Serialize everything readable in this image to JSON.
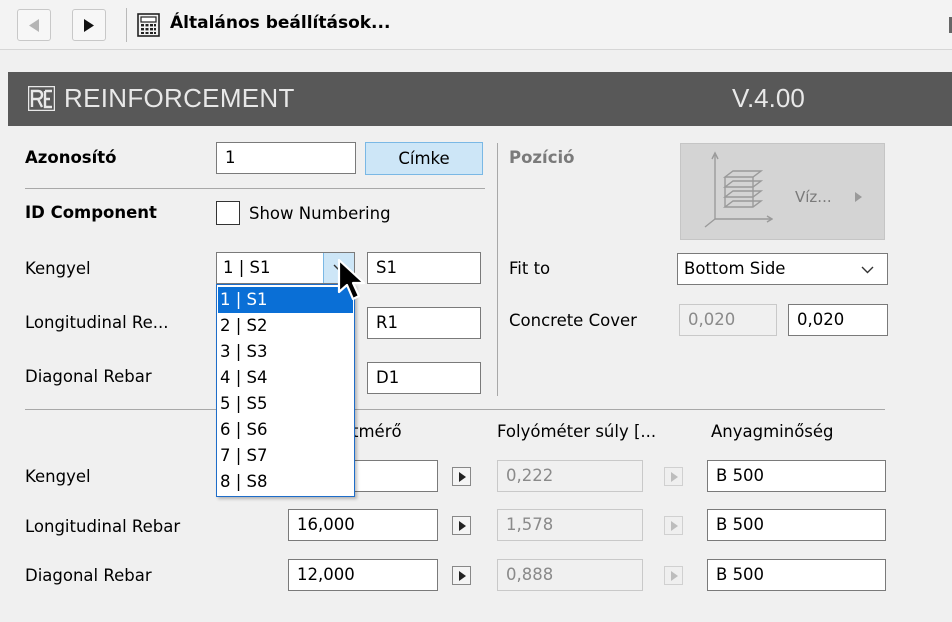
{
  "toolbar": {
    "title": "Általános beállítások..."
  },
  "banner": {
    "logo_text": "RE",
    "title": "REINFORCEMENT",
    "version": "V.4.00"
  },
  "id_section": {
    "azonosito_label": "Azonosító",
    "azonosito_value": "1",
    "cimke_button": "Címke",
    "id_component_label": "ID Component",
    "show_numbering_label": "Show Numbering",
    "show_numbering_checked": false
  },
  "rebar_ids": {
    "kengyel_label": "Kengyel",
    "kengyel_select": "1 | S1",
    "kengyel_id": "S1",
    "longitudinal_label": "Longitudinal Re...",
    "longitudinal_id": "R1",
    "diagonal_label": "Diagonal Rebar",
    "diagonal_id": "D1"
  },
  "position": {
    "pozicio_label": "Pozíció",
    "preview_label": "Víz...",
    "fit_to_label": "Fit to",
    "fit_to_value": "Bottom Side",
    "concrete_cover_label": "Concrete Cover",
    "concrete_cover_default": "0,020",
    "concrete_cover_value": "0,020"
  },
  "table": {
    "headers": {
      "diameter": "tmérő",
      "weight": "Folyóméter súly [...",
      "material": "Anyagminőség"
    },
    "rows": [
      {
        "label": "Kengyel",
        "diameter": "",
        "weight": "0,222",
        "material": "B 500"
      },
      {
        "label": "Longitudinal Rebar",
        "diameter": "16,000",
        "weight": "1,578",
        "material": "B 500"
      },
      {
        "label": "Diagonal Rebar",
        "diameter": "12,000",
        "weight": "0,888",
        "material": "B 500"
      }
    ]
  },
  "dropdown": {
    "options": [
      "1 | S1",
      "2 | S2",
      "3 | S3",
      "4 | S4",
      "5 | S5",
      "6 | S6",
      "7 | S7",
      "8 | S8"
    ],
    "selected_index": 0
  }
}
